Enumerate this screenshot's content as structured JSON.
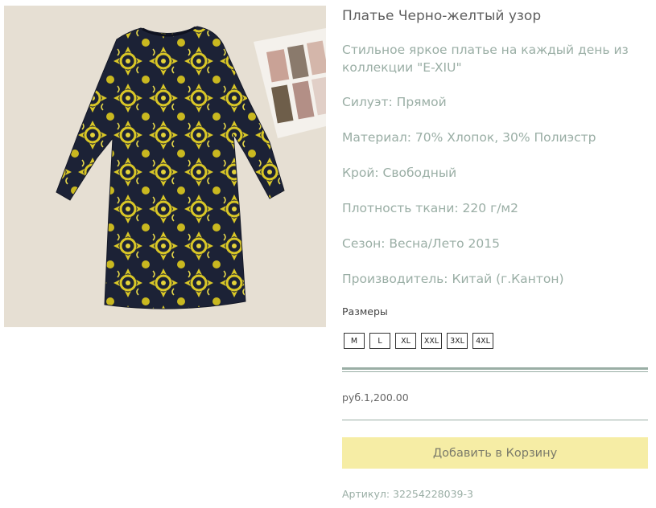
{
  "product": {
    "title": "Платье Черно-желтый узор",
    "description": "Стильное яркое платье на каждый день из коллекции \"E-XIU\"",
    "specs": [
      "Силуэт: Прямой",
      "Материал: 70% Хлопок, 30% Полиэстр",
      "Крой: Свободный",
      "Плотность ткани: 220 г/м2",
      "Сезон: Весна/Лето 2015",
      "Производитель: Китай (г.Кантон)"
    ],
    "sizes_label": "Размеры",
    "sizes": [
      "M",
      "L",
      "XL",
      "XXL",
      "3XL",
      "4XL"
    ],
    "price": "руб.1,200.00",
    "add_to_cart_label": "Добавить в Корзину",
    "sku": "Артикул: 32254228039-3",
    "image_alt": "dress-photo"
  },
  "colors": {
    "accent_text": "#9aaea5",
    "button_bg": "#f6eda5",
    "dress_base": "#1c2236",
    "dress_pattern": "#d9c727"
  }
}
